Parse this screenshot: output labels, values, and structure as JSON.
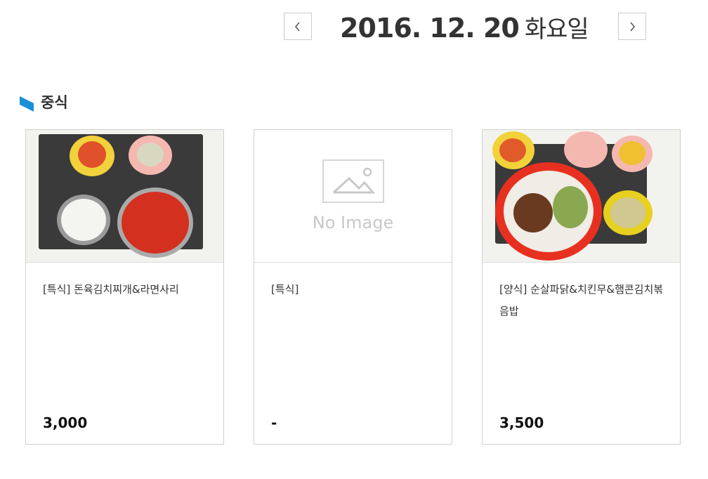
{
  "header": {
    "date": "2016. 12. 20",
    "weekday": "화요일",
    "prev_icon": "chevron-left-icon",
    "next_icon": "chevron-right-icon"
  },
  "section": {
    "title": "중식",
    "accent": "#1a8fd8"
  },
  "menu": [
    {
      "title": "[특식] 돈육김치찌개&라면사리",
      "price": "3,000",
      "has_image": true
    },
    {
      "title": "[특식]",
      "price": "-",
      "has_image": false,
      "no_image_label": "No Image"
    },
    {
      "title": "[양식] 순살파닭&치킨무&햄콘김치볶음밥",
      "price": "3,500",
      "has_image": true
    }
  ]
}
